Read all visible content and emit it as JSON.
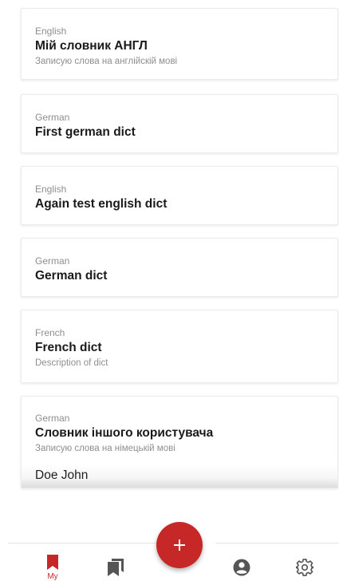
{
  "dictionaries": [
    {
      "language": "English",
      "title": "Мій словник АНГЛ",
      "description": "Записую слова на англійскій мові"
    },
    {
      "language": "German",
      "title": "First german dict"
    },
    {
      "language": "English",
      "title": "Again test english dict"
    },
    {
      "language": "German",
      "title": "German dict"
    },
    {
      "language": "French",
      "title": "French dict",
      "description": "Description of dict"
    },
    {
      "language": "German",
      "title": "Словник іншого користувача",
      "description": "Записую слова на німецькій мові",
      "owner": "Doe John"
    }
  ],
  "nav": {
    "my_label": "My",
    "active_color": "#c62828",
    "inactive_color": "#555555",
    "items": [
      "bookmark-icon",
      "bookmarks-icon",
      "account-icon",
      "settings-icon"
    ]
  },
  "fab": {
    "icon": "plus-icon",
    "color": "#c62828"
  }
}
